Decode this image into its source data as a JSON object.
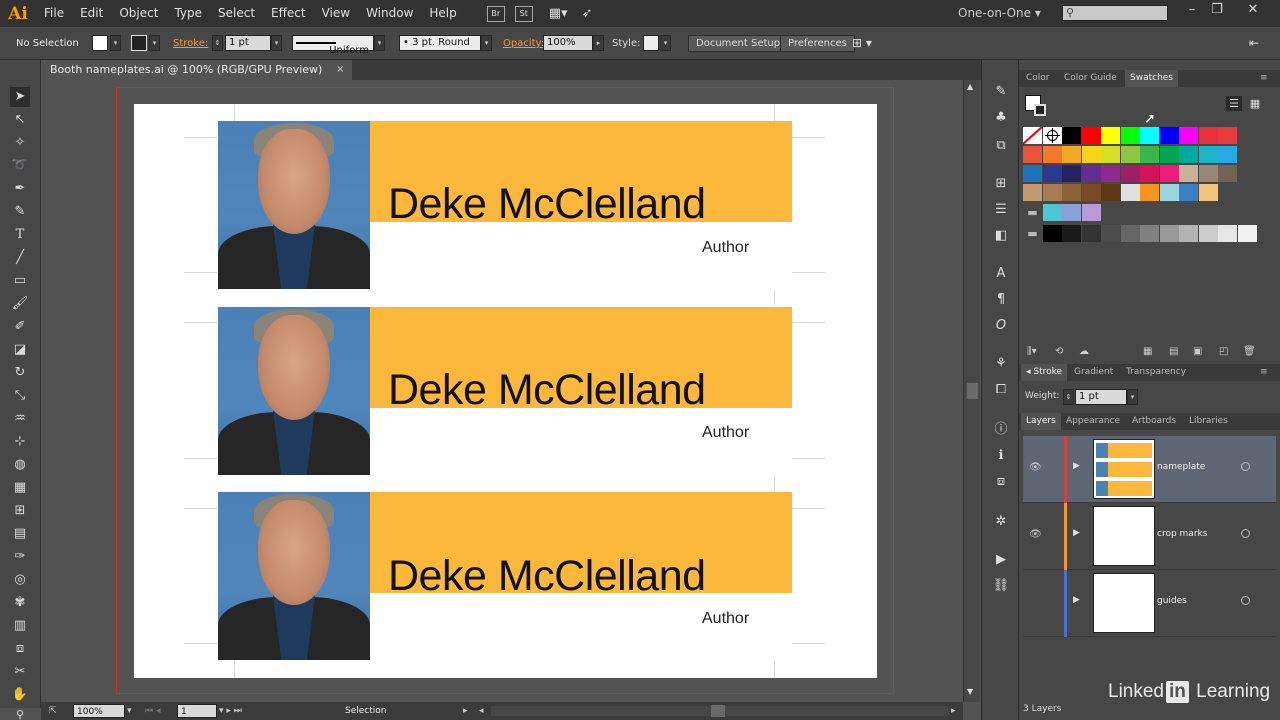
{
  "app": {
    "logo": "Ai"
  },
  "menu": [
    "File",
    "Edit",
    "Object",
    "Type",
    "Select",
    "Effect",
    "View",
    "Window",
    "Help"
  ],
  "bridge_buttons": [
    "Br",
    "St"
  ],
  "workspace": "One-on-One",
  "window_controls": [
    "–",
    "❐",
    "✕"
  ],
  "controlbar": {
    "selection": "No Selection",
    "stroke_label": "Stroke:",
    "stroke_weight": "1 pt",
    "profile": "Uniform",
    "brush": "3 pt. Round",
    "opacity_label": "Opacity:",
    "opacity_value": "100%",
    "style_label": "Style:",
    "doc_setup": "Document Setup",
    "preferences": "Preferences"
  },
  "document_tab": {
    "title": "Booth nameplates.ai @ 100% (RGB/GPU Preview)",
    "close": "×"
  },
  "nameplates": [
    {
      "name": "Deke McClelland",
      "title": "Author"
    },
    {
      "name": "Deke McClelland",
      "title": "Author"
    },
    {
      "name": "Deke McClelland",
      "title": "Author"
    }
  ],
  "statusbar": {
    "zoom": "100%",
    "artboard": "1",
    "tool": "Selection"
  },
  "swatches_panel": {
    "tabs": [
      "Color",
      "Color Guide",
      "Swatches"
    ],
    "row1": [
      "#ffffff",
      "#ffffff",
      "#000000",
      "#ff0000",
      "#ffff00",
      "#00ff00",
      "#00ffff",
      "#0000ff",
      "#ff00ff",
      "#e8303a",
      "#e83a3a"
    ],
    "row2": [
      "#e8533a",
      "#f07a2a",
      "#f5a623",
      "#f7d21e",
      "#d6e021",
      "#8dc63f",
      "#39b54a",
      "#00a651",
      "#00a99d",
      "#1bb5c9",
      "#27aae1"
    ],
    "row3": [
      "#1c75bc",
      "#2b3990",
      "#262262",
      "#662d91",
      "#92278f",
      "#9e1f63",
      "#d4145a",
      "#ed1e79",
      "#c7b299",
      "#998675",
      "#736357"
    ],
    "row4": [
      "#c49a6c",
      "#a67c52",
      "#8c6239",
      "#754c24",
      "#603813",
      "#e0e0e0",
      "#f7941d",
      "#9bd5e0",
      "#3b7fc4",
      "#f5c27a"
    ],
    "group1": [
      "#4ec7d4",
      "#8aa1d6",
      "#b89ad6"
    ],
    "grays": [
      "#000000",
      "#1a1a1a",
      "#333333",
      "#4d4d4d",
      "#666666",
      "#808080",
      "#999999",
      "#b3b3b3",
      "#cccccc",
      "#e6e6e6",
      "#f2f2f2"
    ]
  },
  "stroke_panel": {
    "tabs": [
      "Stroke",
      "Gradient",
      "Transparency"
    ],
    "weight_label": "Weight:",
    "weight_value": "1 pt"
  },
  "layers_panel": {
    "tabs": [
      "Layers",
      "Appearance",
      "Artboards",
      "Libraries"
    ],
    "layers": [
      {
        "name": "nameplate",
        "color": "#d43f3a"
      },
      {
        "name": "crop marks",
        "color": "#f29a2e"
      },
      {
        "name": "guides",
        "color": "#4a6fd4"
      }
    ],
    "count": "3 Layers"
  },
  "watermark": {
    "text_pre": "Linked",
    "text_in": "in",
    "text_post": " Learning"
  }
}
